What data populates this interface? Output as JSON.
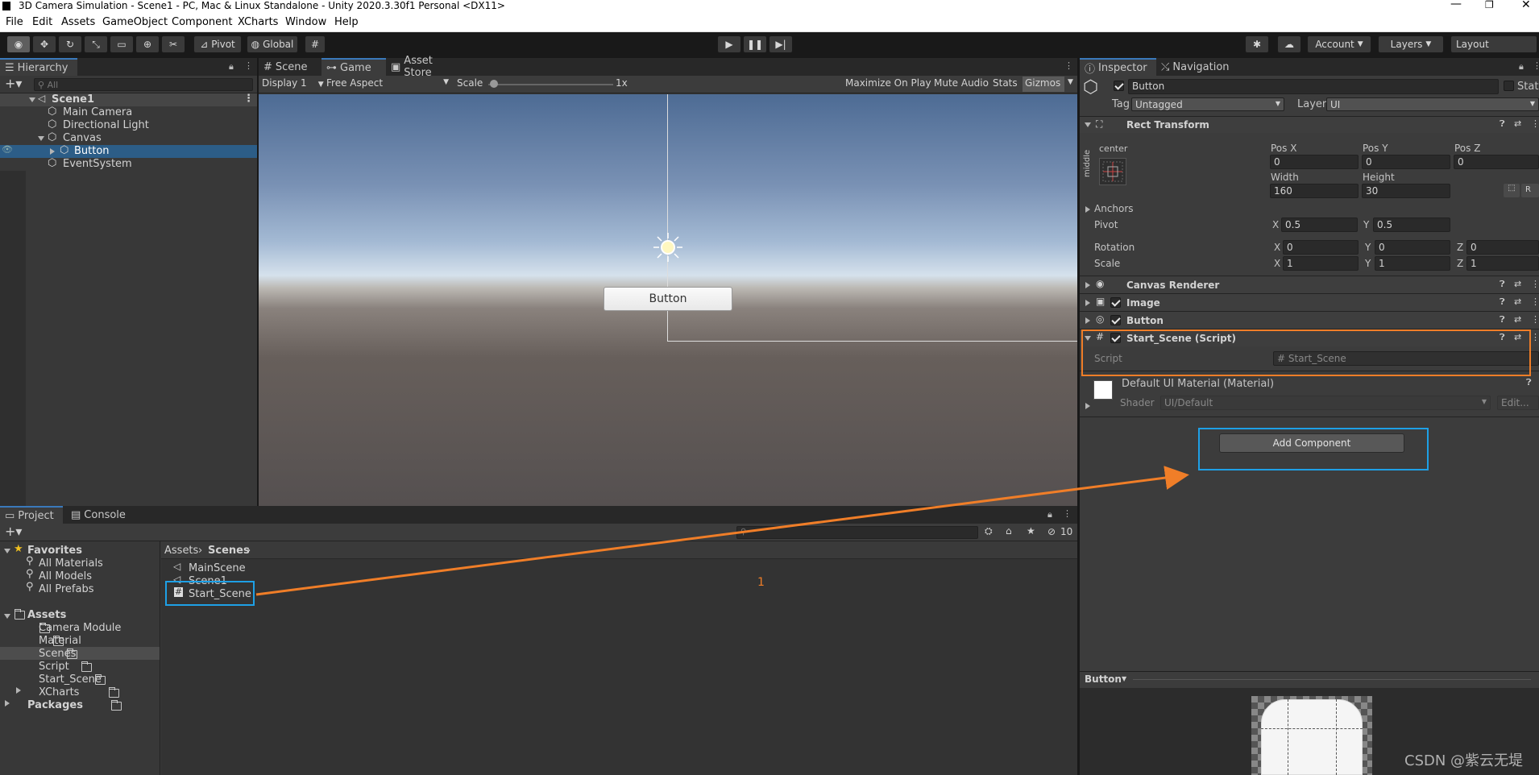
{
  "window": {
    "title": "3D Camera Simulation - Scene1 - PC, Mac & Linux Standalone - Unity 2020.3.30f1 Personal <DX11>"
  },
  "menu": [
    "File",
    "Edit",
    "Assets",
    "GameObject",
    "Component",
    "XCharts",
    "Window",
    "Help"
  ],
  "toolbar": {
    "pivot": "Pivot",
    "global": "Global",
    "account": "Account",
    "layers": "Layers",
    "layout": "Layout"
  },
  "hierarchy": {
    "tab": "Hierarchy",
    "search_placeholder": "All",
    "scene": "Scene1",
    "items": [
      "Main Camera",
      "Directional Light",
      "Canvas",
      "Button",
      "EventSystem"
    ]
  },
  "view_tabs": {
    "scene": "Scene",
    "game": "Game",
    "asset_store": "Asset Store"
  },
  "game_bar": {
    "display": "Display 1",
    "aspect": "Free Aspect",
    "scale_label": "Scale",
    "scale_value": "1x",
    "maximize": "Maximize On Play",
    "mute": "Mute Audio",
    "stats": "Stats",
    "gizmos": "Gizmos"
  },
  "game_view": {
    "button_label": "Button"
  },
  "inspector": {
    "tabs": {
      "inspector": "Inspector",
      "navigation": "Navigation"
    },
    "object_name": "Button",
    "static": "Static",
    "tag_label": "Tag",
    "tag_value": "Untagged",
    "layer_label": "Layer",
    "layer_value": "UI",
    "rect": {
      "title": "Rect Transform",
      "anchor_h": "center",
      "anchor_v": "middle",
      "pos_x_label": "Pos X",
      "pos_y_label": "Pos Y",
      "pos_z_label": "Pos Z",
      "pos_x": "0",
      "pos_y": "0",
      "pos_z": "0",
      "width_label": "Width",
      "height_label": "Height",
      "width": "160",
      "height": "30",
      "anchors": "Anchors",
      "pivot": "Pivot",
      "pivot_x": "0.5",
      "pivot_y": "0.5",
      "rotation": "Rotation",
      "rot_x": "0",
      "rot_y": "0",
      "rot_z": "0",
      "scale": "Scale",
      "scale_x": "1",
      "scale_y": "1",
      "scale_z": "1",
      "r_btn": "R"
    },
    "components": [
      "Canvas Renderer",
      "Image",
      "Button"
    ],
    "script_comp": {
      "title": "Start_Scene (Script)",
      "script_label": "Script",
      "script_value": "Start_Scene"
    },
    "material": {
      "name": "Default UI Material (Material)",
      "shader_label": "Shader",
      "shader_value": "UI/Default",
      "edit": "Edit..."
    },
    "add_component": "Add Component",
    "preview_label": "Button"
  },
  "project": {
    "tabs": {
      "project": "Project",
      "console": "Console"
    },
    "favorites": {
      "title": "Favorites",
      "items": [
        "All Materials",
        "All Models",
        "All Prefabs"
      ]
    },
    "assets": {
      "title": "Assets",
      "items": [
        "Camera Module",
        "Material",
        "Scenes",
        "Script",
        "Start_Scene",
        "XCharts"
      ]
    },
    "packages": "Packages",
    "breadcrumb": [
      "Assets",
      "Scenes"
    ],
    "files": [
      "MainScene",
      "Scene1",
      "Start_Scene"
    ],
    "count": "10",
    "annotation": "1"
  },
  "watermark": "CSDN @紫云无堤",
  "colors": {
    "annotation_orange": "#f07e28",
    "annotation_blue": "#1ea0e6",
    "selection": "#2c5d87",
    "accent": "#3a79bb"
  }
}
